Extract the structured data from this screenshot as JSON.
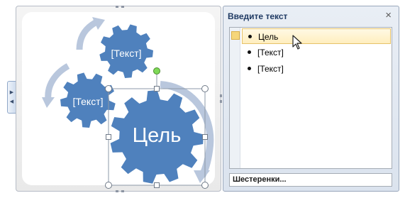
{
  "canvas": {
    "gears": [
      {
        "id": "gear-top",
        "text": "[Текст]"
      },
      {
        "id": "gear-left",
        "text": "[Текст]"
      },
      {
        "id": "gear-main",
        "text": "Цель"
      }
    ]
  },
  "text_pane": {
    "title": "Введите текст",
    "close_icon": "close-icon",
    "items": [
      {
        "label": "Цель",
        "selected": true
      },
      {
        "label": "[Текст]",
        "selected": false
      },
      {
        "label": "[Текст]",
        "selected": false
      }
    ],
    "layout_name": "Шестеренки..."
  },
  "colors": {
    "gear_fill": "#4f81bd",
    "arrow_fill": "#b9c7dd",
    "selection": "#ffeebe",
    "pane_bg": "#dbe3ee"
  }
}
